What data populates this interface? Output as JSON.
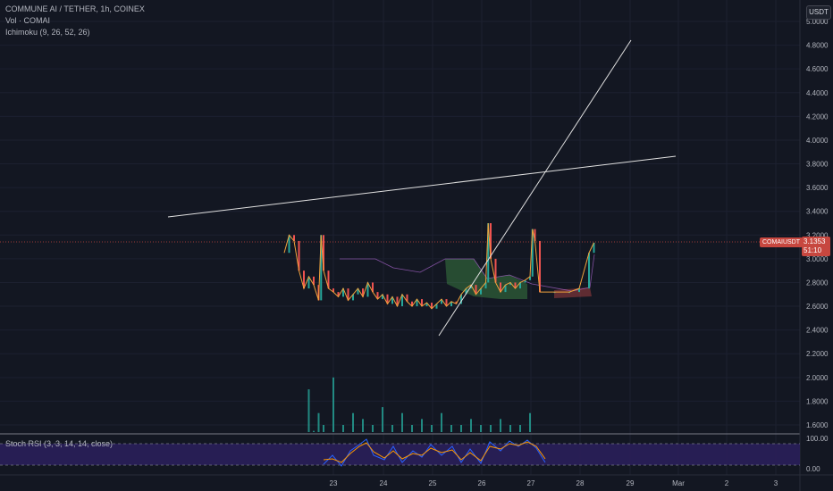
{
  "header": {
    "title": "COMMUNE AI / TETHER, 1h, COINEX",
    "volume_label": "Vol · COMAI",
    "ichimoku_label": "Ichimoku (9, 26, 52, 26)"
  },
  "currency_button": "USDT",
  "price_tag": {
    "symbol": "COMAIUSDT",
    "price": "3.1353",
    "countdown": "51:10",
    "color": "#c7473f"
  },
  "price_axis": {
    "ticks": [
      "5.0000",
      "4.8000",
      "4.6000",
      "4.4000",
      "4.2000",
      "4.0000",
      "3.8000",
      "3.6000",
      "3.4000",
      "3.2000",
      "3.0000",
      "2.8000",
      "2.6000",
      "2.4000",
      "2.2000",
      "2.0000",
      "1.8000",
      "1.6000"
    ]
  },
  "time_axis": {
    "ticks": [
      "23",
      "24",
      "25",
      "26",
      "27",
      "28",
      "29",
      "Mar",
      "2",
      "3"
    ]
  },
  "rsi": {
    "label": "Stoch RSI (3, 3, 14, 14, close)",
    "ticks": [
      "100.00",
      "0.00"
    ],
    "band_color": "#2a1f5a"
  },
  "colors": {
    "background": "#131722",
    "price_line": "#f2a33c",
    "up_candle": "#26a69a",
    "down_candle": "#ef5350",
    "trendline": "#ffffff",
    "kumo_bull": "#4caf50",
    "kumo_bear": "#ef5350"
  },
  "chart_data": {
    "type": "line",
    "title": "COMMUNE AI / TETHER, 1h, COINEX",
    "ylim": [
      1.5,
      5.0
    ],
    "x_categories": [
      "23",
      "24",
      "25",
      "26",
      "27",
      "28",
      "29",
      "Mar",
      "2",
      "3"
    ],
    "last_price": 3.1353,
    "series": [
      {
        "name": "COMAIUSDT",
        "points": [
          [
            22.0,
            3.05
          ],
          [
            22.1,
            3.2
          ],
          [
            22.2,
            3.15
          ],
          [
            22.3,
            2.9
          ],
          [
            22.4,
            2.75
          ],
          [
            22.5,
            2.85
          ],
          [
            22.6,
            2.78
          ],
          [
            22.7,
            2.65
          ],
          [
            22.75,
            3.2
          ],
          [
            22.8,
            2.9
          ],
          [
            22.9,
            2.75
          ],
          [
            23.0,
            2.72
          ],
          [
            23.1,
            2.68
          ],
          [
            23.2,
            2.75
          ],
          [
            23.3,
            2.65
          ],
          [
            23.4,
            2.7
          ],
          [
            23.5,
            2.75
          ],
          [
            23.6,
            2.68
          ],
          [
            23.7,
            2.8
          ],
          [
            23.8,
            2.72
          ],
          [
            23.9,
            2.66
          ],
          [
            24.0,
            2.7
          ],
          [
            24.1,
            2.62
          ],
          [
            24.2,
            2.68
          ],
          [
            24.3,
            2.6
          ],
          [
            24.4,
            2.7
          ],
          [
            24.5,
            2.64
          ],
          [
            24.6,
            2.6
          ],
          [
            24.7,
            2.66
          ],
          [
            24.8,
            2.6
          ],
          [
            24.9,
            2.63
          ],
          [
            25.0,
            2.58
          ],
          [
            25.1,
            2.62
          ],
          [
            25.2,
            2.66
          ],
          [
            25.3,
            2.6
          ],
          [
            25.4,
            2.64
          ],
          [
            25.5,
            2.62
          ],
          [
            25.6,
            2.7
          ],
          [
            25.7,
            2.75
          ],
          [
            25.8,
            2.78
          ],
          [
            25.9,
            2.7
          ],
          [
            26.0,
            2.75
          ],
          [
            26.1,
            2.8
          ],
          [
            26.15,
            3.3
          ],
          [
            26.2,
            3.0
          ],
          [
            26.3,
            2.8
          ],
          [
            26.4,
            2.72
          ],
          [
            26.5,
            2.78
          ],
          [
            26.6,
            2.8
          ],
          [
            26.7,
            2.75
          ],
          [
            26.8,
            2.8
          ],
          [
            26.9,
            2.82
          ],
          [
            27.0,
            2.85
          ],
          [
            27.05,
            3.25
          ],
          [
            27.1,
            3.15
          ],
          [
            27.2,
            2.72
          ],
          [
            27.5,
            2.72
          ],
          [
            27.8,
            2.72
          ],
          [
            28.0,
            2.75
          ],
          [
            28.2,
            3.05
          ],
          [
            28.3,
            3.1353
          ]
        ]
      }
    ],
    "volume": [
      [
        22.5,
        1.9
      ],
      [
        22.6,
        1.55
      ],
      [
        22.7,
        1.7
      ],
      [
        22.8,
        1.6
      ],
      [
        23.0,
        2.0
      ],
      [
        23.2,
        1.6
      ],
      [
        23.4,
        1.7
      ],
      [
        23.6,
        1.65
      ],
      [
        23.8,
        1.6
      ],
      [
        24.0,
        1.75
      ],
      [
        24.2,
        1.6
      ],
      [
        24.4,
        1.7
      ],
      [
        24.6,
        1.6
      ],
      [
        24.8,
        1.65
      ],
      [
        25.0,
        1.6
      ],
      [
        25.2,
        1.7
      ],
      [
        25.4,
        1.6
      ],
      [
        25.6,
        1.6
      ],
      [
        25.8,
        1.65
      ],
      [
        26.0,
        1.6
      ],
      [
        26.2,
        1.6
      ],
      [
        26.4,
        1.65
      ],
      [
        26.6,
        1.6
      ],
      [
        26.8,
        1.6
      ],
      [
        27.0,
        1.7
      ]
    ]
  }
}
